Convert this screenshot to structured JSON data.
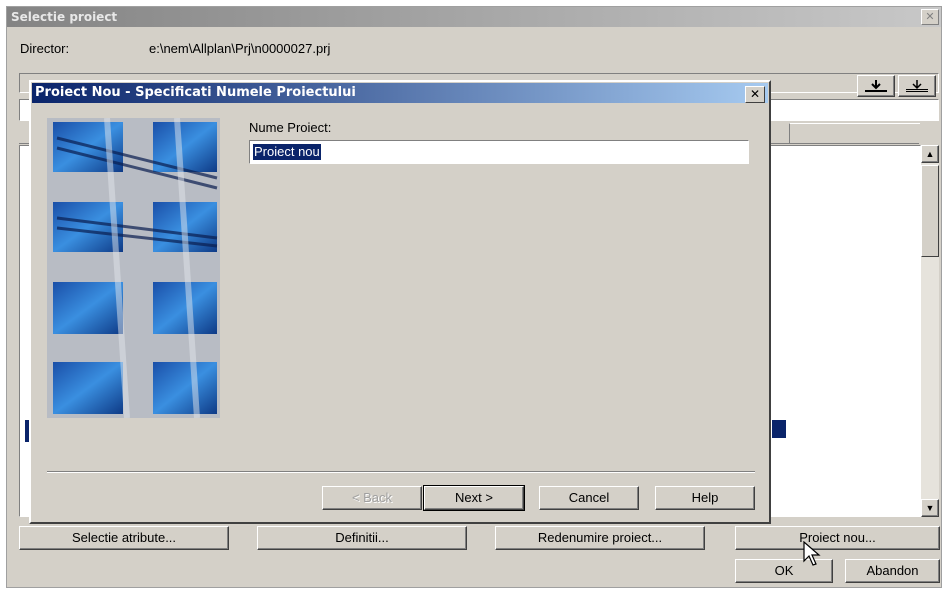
{
  "outer_window": {
    "title": "Selectie proiect",
    "director_label": "Director:",
    "director_value": "e:\\nem\\Allplan\\Prj\\n0000027.prj",
    "buttons": {
      "selectie_atribute": "Selectie atribute...",
      "definitii": "Definitii...",
      "redenumire_proiect": "Redenumire proiect...",
      "proiect_nou": "Proiect nou...",
      "ok": "OK",
      "abandon": "Abandon"
    },
    "close_glyph": "✕"
  },
  "dialog": {
    "title": "Proiect Nou - Specificati Numele Proiectului",
    "name_label": "Nume Proiect:",
    "name_value": "Proiect nou",
    "close_glyph": "✕",
    "buttons": {
      "back": "< Back",
      "next": "Next >",
      "cancel": "Cancel",
      "help": "Help"
    }
  },
  "icons": [
    "close-icon",
    "scroll-up-icon",
    "scroll-down-icon",
    "mouse-cursor-icon",
    "sort-down-icon"
  ]
}
